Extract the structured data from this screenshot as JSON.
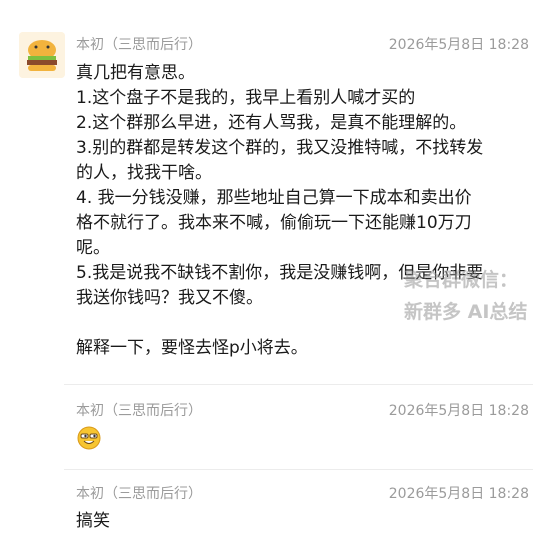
{
  "messages": [
    {
      "sender": "本初（三思而后行）",
      "time": "2026年5月8日 18:28",
      "lines": [
        "真几把有意思。",
        "1.这个盘子不是我的，我早上看别人喊才买的",
        "2.这个群那么早进，还有人骂我，是真不能理解的。",
        "3.别的群都是转发这个群的，我又没推特喊，不找转发",
        "的人，找我干啥。",
        "4. 我一分钱没赚，那些地址自己算一下成本和卖出价",
        "格不就行了。我本来不喊，偷偷玩一下还能赚10万刀",
        "呢。",
        "5.我是说我不缺钱不割你，我是没赚钱啊，但是你非要",
        "我送你钱吗？我又不傻。",
        "",
        "解释一下，要怪去怪p小将去。"
      ]
    },
    {
      "sender": "本初（三思而后行）",
      "time": "2026年5月8日 18:28",
      "emoji": "grinning-face-sunglasses-emoji"
    },
    {
      "sender": "本初（三思而后行）",
      "time": "2026年5月8日 18:28",
      "text": "搞笑"
    }
  ],
  "watermark": {
    "line1": "聚合群微信：",
    "line2": "新群多 AI总结"
  },
  "colors": {
    "sender": "#9b9b9b",
    "text": "#1a1a1a",
    "divider": "#ececec"
  }
}
